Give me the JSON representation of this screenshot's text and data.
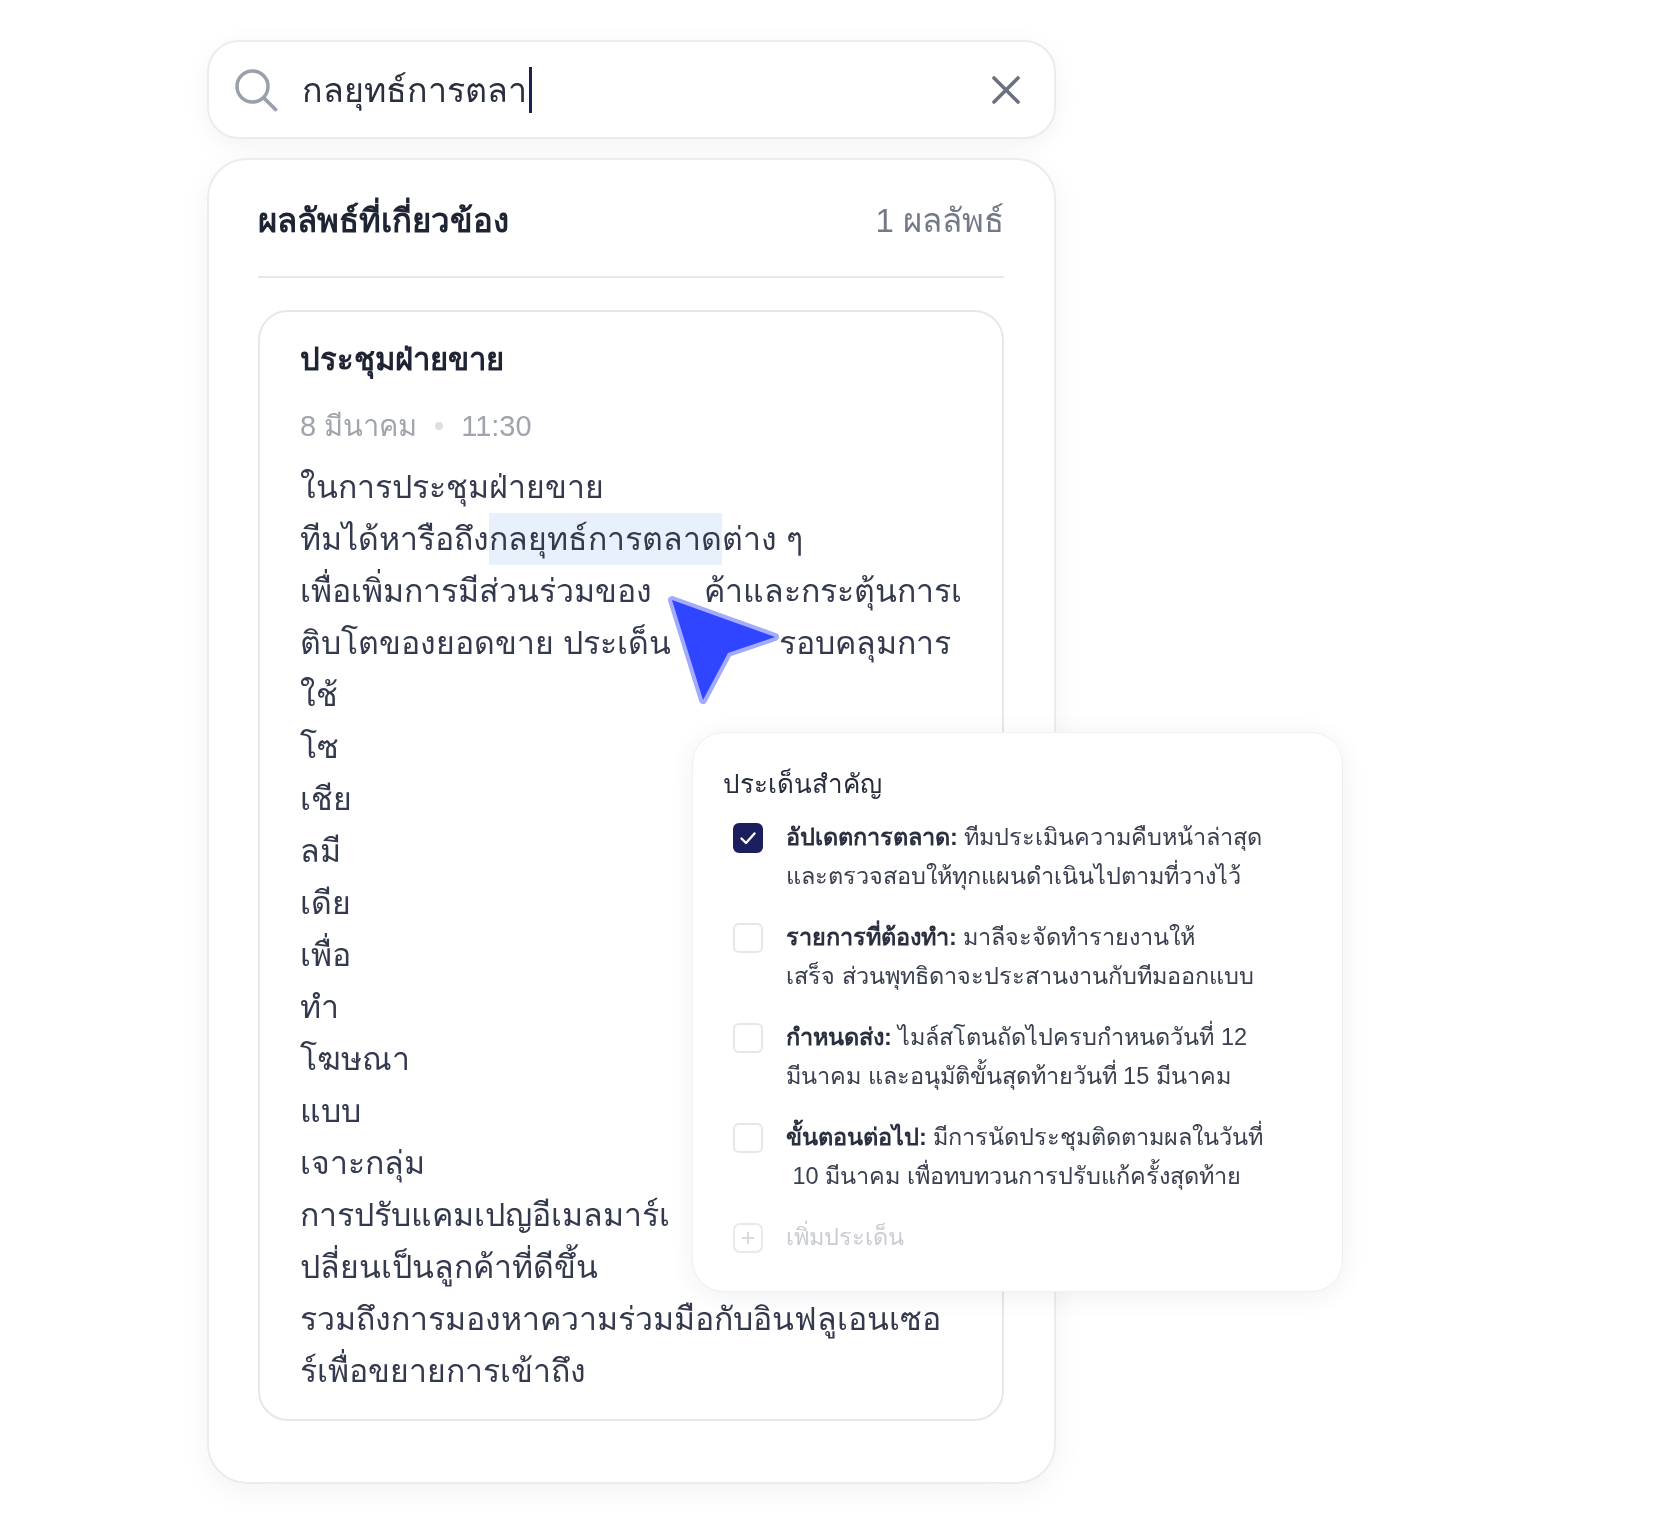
{
  "search": {
    "value": "กลยุทธ์การตลา",
    "focused": true
  },
  "results": {
    "title": "ผลลัพธ์ที่เกี่ยวข้อง",
    "count": "1 ผลลัพธ์",
    "items": [
      {
        "title": "ประชุมฝ่ายขาย",
        "date": "8 มีนาคม",
        "time": "11:30",
        "lines": [
          {
            "pieces": [
              {
                "text": "ในการประชุมฝ่ายขาย",
                "highlighted": false
              }
            ]
          },
          {
            "pieces": [
              {
                "text": "ทีมได้หารือถึง",
                "highlighted": false
              },
              {
                "text": "กลยุทธ์การตลาด",
                "highlighted": true
              },
              {
                "text": "ต่าง ๆ",
                "highlighted": false
              }
            ]
          },
          {
            "pieces": [
              {
                "text": "เพื่อเพิ่มการมีส่วนร่วมของ",
                "highlighted": false
              }
            ],
            "after_cursor": [
              {
                "text": "ค้าและกระตุ้นการเ",
                "highlighted": false
              }
            ]
          },
          {
            "pieces": [
              {
                "text": "ติบโตของยอดขาย ประเด็น",
                "highlighted": false
              }
            ],
            "after_cursor": [
              {
                "text": "รอบคลุมการ",
                "highlighted": false
              }
            ]
          },
          {
            "pieces": [
              {
                "text": "ใช้",
                "highlighted": false
              }
            ]
          },
          {
            "pieces": [
              {
                "text": "โซ",
                "highlighted": false
              }
            ]
          },
          {
            "pieces": [
              {
                "text": "เชีย",
                "highlighted": false
              }
            ]
          },
          {
            "pieces": [
              {
                "text": "ลมี",
                "highlighted": false
              }
            ]
          },
          {
            "pieces": [
              {
                "text": "เดีย",
                "highlighted": false
              }
            ]
          },
          {
            "pieces": [
              {
                "text": "เพื่อ",
                "highlighted": false
              }
            ]
          },
          {
            "pieces": [
              {
                "text": "ทำ",
                "highlighted": false
              }
            ]
          },
          {
            "pieces": [
              {
                "text": "โฆษณา",
                "highlighted": false
              }
            ]
          },
          {
            "pieces": [
              {
                "text": "แบบ",
                "highlighted": false
              }
            ]
          },
          {
            "pieces": [
              {
                "text": "เจาะกลุ่ม",
                "highlighted": false
              }
            ]
          },
          {
            "pieces": [
              {
                "text": "การปรับแคมเปญอีเมลมาร์เ",
                "highlighted": false
              }
            ]
          },
          {
            "pieces": [
              {
                "text": "ปลี่ยนเป็นลูกค้าที่ดีขึ้น",
                "highlighted": false
              }
            ]
          },
          {
            "pieces": [
              {
                "text": "รวมถึงการมองหาความร่วมมือกับอินฟลูเอนเซอ",
                "highlighted": false
              }
            ]
          },
          {
            "pieces": [
              {
                "text": "ร์เพื่อขยายการเข้าถึง",
                "highlighted": false
              }
            ]
          }
        ]
      }
    ]
  },
  "key_points": {
    "title": "ประเด็นสำคัญ",
    "items": [
      {
        "text": "**อัปเดตการตลาด:** ทีมประเมินความคืบหน้าล่าสุด\nและตรวจสอบให้ทุกแผนดำเนินไปตามที่วางไว้",
        "checked": true
      },
      {
        "text": "**รายการที่ต้องทำ:** มาลีจะจัดทำรายงานให้\nเสร็จ ส่วนพุทธิดาจะประสานงานกับทีมออกแบบ",
        "checked": false
      },
      {
        "text": "**กำหนดส่ง:** ไมล์สโตนถัดไปครบกำหนดวันที่ 12\nมีนาคม และอนุมัติขั้นสุดท้ายวันที่ 15 มีนาคม",
        "checked": false
      },
      {
        "text": "**ขั้นตอนต่อไป:** มีการนัดประชุมติดตามผลในวันที่\n 10 มีนาคม เพื่อทบทวนการปรับแก้ครั้งสุดท้าย",
        "checked": false
      }
    ],
    "add_label": "เพิ่มประเด็น"
  }
}
